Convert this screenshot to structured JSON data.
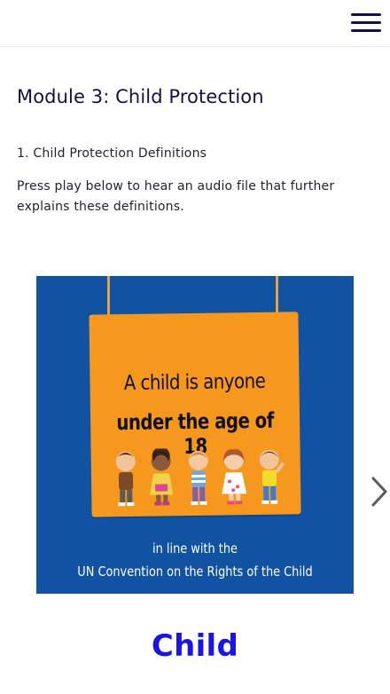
{
  "header": {
    "menu_icon": "hamburger-menu-icon"
  },
  "module": {
    "title": "Module 3: Child Protection",
    "section_heading": "1. Child Protection Definitions",
    "description": "Press play below to hear an audio file that further explains these definitions."
  },
  "slide": {
    "sign_line1": "A child is anyone",
    "sign_line2": "under the age of 18",
    "caption_line1": "in line with the",
    "caption_line2": "UN Convention on the Rights of the Child",
    "title": "Child",
    "next_icon": "chevron-right-icon",
    "background_color": "#1153a2",
    "sign_color": "#f6981e"
  },
  "colors": {
    "title": "#13104a",
    "accent": "#1a14ea"
  }
}
